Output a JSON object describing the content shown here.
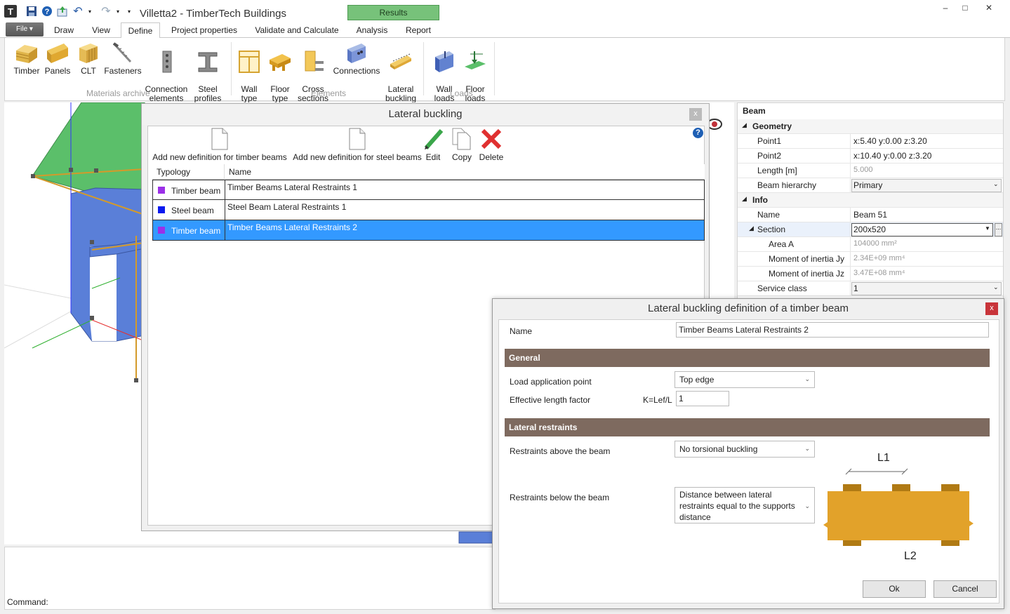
{
  "window": {
    "title": "Villetta2 - TimberTech Buildings",
    "context_tab": "Results",
    "controls": [
      "–",
      "□",
      "✕"
    ]
  },
  "menu": {
    "file": "File",
    "tabs": [
      "Draw",
      "View",
      "Define",
      "Project properties",
      "Validate and Calculate",
      "Analysis",
      "Report"
    ]
  },
  "ribbon": {
    "materials": [
      "Timber",
      "Panels",
      "CLT",
      "Fasteners",
      "Connection\nelements",
      "Steel\nprofiles"
    ],
    "elements": [
      "Wall\ntype",
      "Floor\ntype",
      "Cross\nsections",
      "Connections",
      "Lateral\nbuckling"
    ],
    "loads": [
      "Wall\nloads",
      "Floor\nloads"
    ],
    "groups": [
      "Materials archive",
      "Elements",
      "Loads"
    ]
  },
  "properties": {
    "header": "Beam",
    "geometry": "Geometry",
    "point1_label": "Point1",
    "point1": "x:5.40 y:0.00 z:3.20",
    "point2_label": "Point2",
    "point2": "x:10.40 y:0.00 z:3.20",
    "length_label": "Length [m]",
    "length": "5.000",
    "hierarchy_label": "Beam hierarchy",
    "hierarchy": "Primary",
    "info": "Info",
    "name_label": "Name",
    "name": "Beam 51",
    "section_label": "Section",
    "section": "200x520",
    "area_label": "Area A",
    "area": "104000 mm²",
    "jy_label": "Moment of inertia Jy",
    "jy": "2.34E+09 mm⁴",
    "jz_label": "Moment of inertia Jz",
    "jz": "3.47E+08 mm⁴",
    "service_label": "Service class",
    "service": "1"
  },
  "lateral_buckling": {
    "title": "Lateral buckling",
    "close": "x",
    "toolbar": {
      "add_timber": "Add new definition for timber beams",
      "add_steel": "Add new definition for steel beams",
      "edit": "Edit",
      "copy": "Copy",
      "delete": "Delete"
    },
    "columns": [
      "Typology",
      "Name"
    ],
    "rows": [
      {
        "typology": "Timber beam",
        "name": "Timber Beams Lateral Restraints 1",
        "color": "#9b30e8"
      },
      {
        "typology": "Steel beam",
        "name": "Steel Beam Lateral Restraints 1",
        "color": "#0a1aef"
      },
      {
        "typology": "Timber beam",
        "name": "Timber Beams Lateral Restraints 2",
        "color": "#9b30e8"
      }
    ]
  },
  "command": {
    "label": "Command:"
  },
  "definition": {
    "title": "Lateral buckling definition of a timber beam",
    "close": "x",
    "name_label": "Name",
    "name_value": "Timber Beams Lateral Restraints 2",
    "general": "General",
    "load_point_label": "Load application point",
    "load_point": "Top edge",
    "eff_label": "Effective length factor",
    "k_label": "K=Lef/L",
    "k_value": "1",
    "restraints": "Lateral restraints",
    "above_label": "Restraints above the beam",
    "above": "No torsional buckling",
    "below_label": "Restraints below the beam",
    "below": "Distance between lateral restraints equal to the supports distance",
    "l1": "L1",
    "l2": "L2",
    "ok": "Ok",
    "cancel": "Cancel"
  }
}
